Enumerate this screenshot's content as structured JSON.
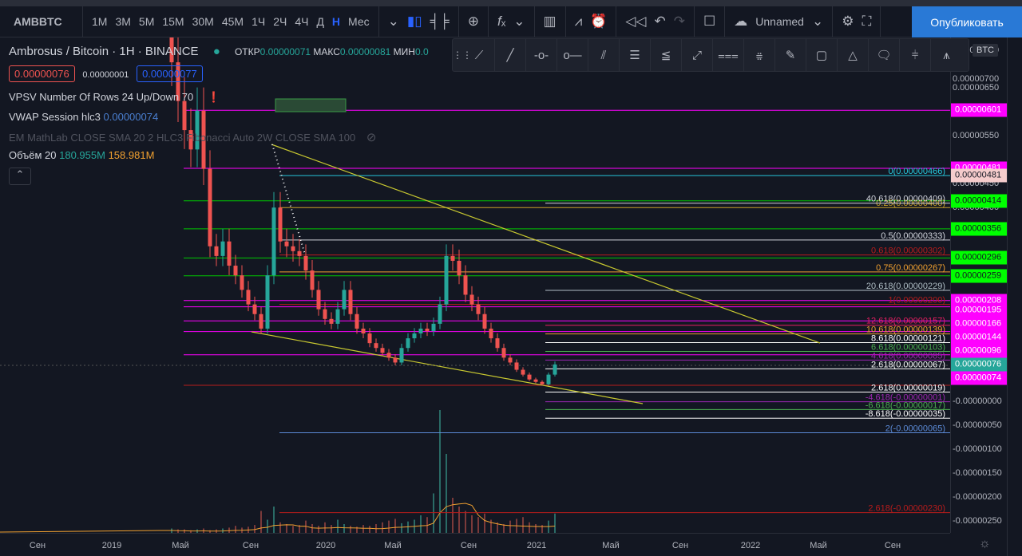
{
  "toolbar": {
    "symbol": "AMBBTC",
    "intervals": [
      "1М",
      "3М",
      "5М",
      "15М",
      "30М",
      "45М",
      "1Ч",
      "2Ч",
      "4Ч",
      "Д",
      "Н",
      "Мес"
    ],
    "active_interval": "Н",
    "layout_name": "Unnamed",
    "publish": "Опубликовать"
  },
  "legend": {
    "title": "Ambrosus / Bitcoin · 1H · BINANCE",
    "open_label": "ОТКР",
    "open": "0.00000071",
    "high_label": "МАКС",
    "high": "0.00000081",
    "low_label": "МИН",
    "low": "0.0",
    "sell": "0.00000076",
    "spread": "0.00000001",
    "buy": "0.00000077",
    "indicators": [
      {
        "name": "VPSV Number Of Rows 24 Up/Down 70"
      },
      {
        "name": "VWAP Session hlc3",
        "value": "0.00000074"
      },
      {
        "name": "EM MathLab CLOSE SMA 20 2 HLC3 Fibonacci Auto 2W CLOSE SMA 100"
      },
      {
        "name": "Объём 20",
        "v1": "180.955M",
        "v2": "158.981M"
      }
    ]
  },
  "price_scale": {
    "currency": "BTC",
    "ticks": [
      "0.00000750",
      "0.00000700",
      "0.00000650",
      "0.00000550",
      "0.00000450",
      "0.00000400",
      "-0.00000000",
      "-0.00000050",
      "-0.00000100",
      "-0.00000150",
      "-0.00000200",
      "-0.00000250"
    ],
    "labels": [
      {
        "text": "0.00000601",
        "v": 601,
        "color": "#ff00ff"
      },
      {
        "text": "0.00000481",
        "v": 481,
        "color": "#ff00ff"
      },
      {
        "text": "0.00000481",
        "v": 466,
        "color": "#f5cccc"
      },
      {
        "text": "0.00000414",
        "v": 414,
        "color": "#00ff00"
      },
      {
        "text": "0.00000356",
        "v": 356,
        "color": "#00ff00"
      },
      {
        "text": "0.00000296",
        "v": 296,
        "color": "#00ff00"
      },
      {
        "text": "0.00000259",
        "v": 259,
        "color": "#00ff00"
      },
      {
        "text": "0.00000208",
        "v": 208,
        "color": "#ff00ff"
      },
      {
        "text": "0.00000195",
        "v": 187,
        "color": "#ff00ff"
      },
      {
        "text": "0.00000166",
        "v": 160,
        "color": "#ff00ff"
      },
      {
        "text": "0.00000144",
        "v": 132,
        "color": "#ff00ff"
      },
      {
        "text": "0.00000096",
        "v": 104,
        "color": "#ff00ff"
      },
      {
        "text": "0.00000076",
        "v": 76,
        "color": "#26a69a"
      },
      {
        "text": "0.00000074",
        "v": 48,
        "color": "#ff00ff"
      }
    ]
  },
  "time_axis": [
    "Сен",
    "2019",
    "Май",
    "Сен",
    "2020",
    "Май",
    "Сен",
    "2021",
    "Май",
    "Сен",
    "2022",
    "Май",
    "Сен"
  ],
  "chart_data": {
    "type": "candlestick",
    "unit": "1e-8 BTC",
    "closes": [
      700,
      620,
      560,
      520,
      600,
      480,
      320,
      300,
      330,
      280,
      260,
      230,
      200,
      180,
      150,
      260,
      400,
      330,
      320,
      310,
      300,
      270,
      230,
      190,
      170,
      160,
      190,
      230,
      180,
      150,
      140,
      120,
      110,
      100,
      90,
      80,
      110,
      130,
      140,
      150,
      145,
      160,
      200,
      300,
      290,
      260,
      220,
      200,
      180,
      150,
      130,
      110,
      90,
      80,
      65,
      55,
      45,
      40,
      35,
      55,
      76
    ],
    "volumes": [
      5,
      4,
      4,
      3,
      4,
      5,
      3,
      4,
      5,
      6,
      8,
      6,
      7,
      9,
      25,
      15,
      30,
      12,
      10,
      8,
      9,
      14,
      10,
      8,
      12,
      9,
      15,
      10,
      8,
      7,
      9,
      8,
      10,
      12,
      14,
      16,
      11,
      13,
      15,
      20,
      18,
      45,
      140,
      90,
      40,
      30,
      25,
      20,
      18,
      22,
      15,
      12,
      10,
      14,
      16,
      18,
      12,
      10,
      9,
      14,
      22
    ],
    "fib_retracement": [
      {
        "label": "0(0.00000466)",
        "v": 466,
        "color": "#26c6da"
      },
      {
        "label": "0.25(0.00000400)",
        "v": 400,
        "color": "#c9a227"
      },
      {
        "label": "0.5(0.00000333)",
        "v": 333,
        "color": "#d1d4dc"
      },
      {
        "label": "0.618(0.00000302)",
        "v": 302,
        "color": "#b71c1c"
      },
      {
        "label": "0.75(0.00000267)",
        "v": 267,
        "color": "#f0a030"
      },
      {
        "label": "1(0.00000200)",
        "v": 200,
        "color": "#b71c1c"
      },
      {
        "label": "2(-0.00000065)",
        "v": -65,
        "color": "#5b8ad6"
      },
      {
        "label": "2.618(-0.00000230)",
        "v": -230,
        "color": "#b71c1c"
      }
    ],
    "fib_extension": [
      {
        "label": "40.618(0.00000409)",
        "v": 409,
        "color": "#d1d4dc"
      },
      {
        "label": "20.618(0.00000229)",
        "v": 229,
        "color": "#b0bec5"
      },
      {
        "label": "12.618(0.00000157)",
        "v": 157,
        "color": "#e91e63"
      },
      {
        "label": "10.618(0.00000139)",
        "v": 139,
        "color": "#f0a030"
      },
      {
        "label": "8.618(0.00000121)",
        "v": 121,
        "color": "#ffffff"
      },
      {
        "label": "6.618(0.00000103)",
        "v": 103,
        "color": "#4caf50"
      },
      {
        "label": "4.618(0.00000085)",
        "v": 85,
        "color": "#9c27b0"
      },
      {
        "label": "2.618(0.00000067)",
        "v": 67,
        "color": "#ffffff"
      },
      {
        "label": "2.618(0.00000019)",
        "v": 19,
        "color": "#ffffff"
      },
      {
        "label": "-4.618(-0.00000001)",
        "v": -1,
        "color": "#9c27b0"
      },
      {
        "label": "-6.618(-0.00000017)",
        "v": -17,
        "color": "#4caf50"
      },
      {
        "label": "-8.618(-0.00000035)",
        "v": -35,
        "color": "#ffffff"
      }
    ],
    "horizontal_levels": [
      {
        "v": 601,
        "color": "#ff00ff"
      },
      {
        "v": 481,
        "color": "#ff00ff"
      },
      {
        "v": 414,
        "color": "#00c800"
      },
      {
        "v": 356,
        "color": "#00c800"
      },
      {
        "v": 296,
        "color": "#00c800"
      },
      {
        "v": 259,
        "color": "#00c800"
      },
      {
        "v": 208,
        "color": "#ff00ff"
      },
      {
        "v": 195,
        "color": "#ff00ff"
      },
      {
        "v": 166,
        "color": "#ff00ff"
      },
      {
        "v": 144,
        "color": "#ff00ff"
      },
      {
        "v": 96,
        "color": "#ff00ff"
      },
      {
        "v": 33,
        "color": "#b71c1c"
      }
    ]
  }
}
